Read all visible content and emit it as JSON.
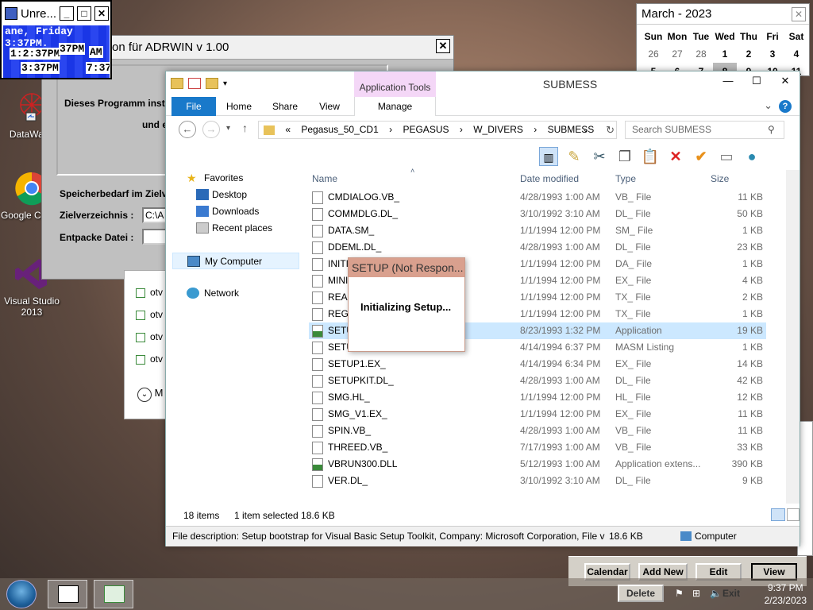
{
  "clock_widget": {
    "title": "Unre...",
    "line1": "ane, Friday 3:37PM.",
    "t1": "1:2:37PM",
    "t2": "37PM",
    "t3": "AM",
    "t4": "3:37PM",
    "t5": "7:37"
  },
  "desktop": {
    "icons": [
      {
        "label": "DataWage"
      },
      {
        "label": "Google Chrom"
      },
      {
        "label": "Visual Studio 2013"
      }
    ]
  },
  "adrwin": {
    "title": "on für ADRWIN v 1.00",
    "text1": "Dieses Programm instal",
    "text2": "und e",
    "space_label": "Speicherbedarf im Zielv",
    "target_label": "Zielverzeichnis :",
    "target_value": "C:\\A",
    "unpack_label": "Entpacke Datei :",
    "unpack_value": ""
  },
  "midwin": {
    "items": [
      "otv",
      "otv",
      "otv",
      "otv"
    ],
    "footer": "M"
  },
  "calendar": {
    "title": "March - 2023",
    "days": [
      "Sun",
      "Mon",
      "Tue",
      "Wed",
      "Thu",
      "Fri",
      "Sat"
    ],
    "row1": [
      "26",
      "27",
      "28",
      "1",
      "2",
      "3",
      "4"
    ],
    "row2": [
      "5",
      "6",
      "7",
      "8",
      "9",
      "10",
      "11"
    ],
    "buttons": {
      "calendar": "Calendar",
      "add_new": "Add New",
      "edit": "Edit",
      "view": "View",
      "delete": "Delete",
      "exit": "Exit"
    }
  },
  "explorer": {
    "window_title": "SUBMESS",
    "context_tab": "Application Tools",
    "tabs": {
      "file": "File",
      "home": "Home",
      "share": "Share",
      "view": "View",
      "manage": "Manage"
    },
    "path": [
      "«",
      "Pegasus_50_CD1",
      "›",
      "PEGASUS",
      "›",
      "W_DIVERS",
      "›",
      "SUBMESS"
    ],
    "search_placeholder": "Search SUBMESS",
    "nav": {
      "favorites": "Favorites",
      "desktop": "Desktop",
      "downloads": "Downloads",
      "recent": "Recent places",
      "computer": "My Computer",
      "network": "Network"
    },
    "columns": {
      "name": "Name",
      "date": "Date modified",
      "type": "Type",
      "size": "Size"
    },
    "files": [
      {
        "name": "CMDIALOG.VB_",
        "date": "4/28/1993 1:00 AM",
        "type": "VB_ File",
        "size": "11 KB"
      },
      {
        "name": "COMMDLG.DL_",
        "date": "3/10/1992 3:10 AM",
        "type": "DL_ File",
        "size": "50 KB"
      },
      {
        "name": "DATA.SM_",
        "date": "1/1/1994 12:00 PM",
        "type": "SM_ File",
        "size": "1 KB"
      },
      {
        "name": "DDEML.DL_",
        "date": "4/28/1993 1:00 AM",
        "type": "DL_ File",
        "size": "23 KB"
      },
      {
        "name": "INITI",
        "date": "1/1/1994 12:00 PM",
        "type": "DA_ File",
        "size": "1 KB"
      },
      {
        "name": "MINI",
        "date": "1/1/1994 12:00 PM",
        "type": "EX_ File",
        "size": "4 KB"
      },
      {
        "name": "READ",
        "date": "1/1/1994 12:00 PM",
        "type": "TX_ File",
        "size": "2 KB"
      },
      {
        "name": "REGI",
        "date": "1/1/1994 12:00 PM",
        "type": "TX_ File",
        "size": "1 KB"
      },
      {
        "name": "SETU",
        "date": "8/23/1993 1:32 PM",
        "type": "Application",
        "size": "19 KB"
      },
      {
        "name": "SETU",
        "date": "4/14/1994 6:37 PM",
        "type": "MASM Listing",
        "size": "1 KB"
      },
      {
        "name": "SETUP1.EX_",
        "date": "4/14/1994 6:34 PM",
        "type": "EX_ File",
        "size": "14 KB"
      },
      {
        "name": "SETUPKIT.DL_",
        "date": "4/28/1993 1:00 AM",
        "type": "DL_ File",
        "size": "42 KB"
      },
      {
        "name": "SMG.HL_",
        "date": "1/1/1994 12:00 PM",
        "type": "HL_ File",
        "size": "12 KB"
      },
      {
        "name": "SMG_V1.EX_",
        "date": "1/1/1994 12:00 PM",
        "type": "EX_ File",
        "size": "11 KB"
      },
      {
        "name": "SPIN.VB_",
        "date": "4/28/1993 1:00 AM",
        "type": "VB_ File",
        "size": "11 KB"
      },
      {
        "name": "THREED.VB_",
        "date": "7/17/1993 1:00 AM",
        "type": "VB_ File",
        "size": "33 KB"
      },
      {
        "name": "VBRUN300.DLL",
        "date": "5/12/1993 1:00 AM",
        "type": "Application extens...",
        "size": "390 KB"
      },
      {
        "name": "VER.DL_",
        "date": "3/10/1992 3:10 AM",
        "type": "DL_ File",
        "size": "9 KB"
      }
    ],
    "status": {
      "items": "18 items",
      "selected": "1 item selected  18.6 KB"
    },
    "infobar": {
      "desc": "File description: Setup bootstrap for Visual Basic Setup Toolkit, Company: Microsoft Corporation, File ve",
      "size": "18.6 KB",
      "location": "Computer"
    }
  },
  "setup_dialog": {
    "title": "SETUP (Not Respon...",
    "message": "Initializing Setup..."
  },
  "taskbar": {
    "time": "9:37 PM",
    "date": "2/23/2023"
  }
}
